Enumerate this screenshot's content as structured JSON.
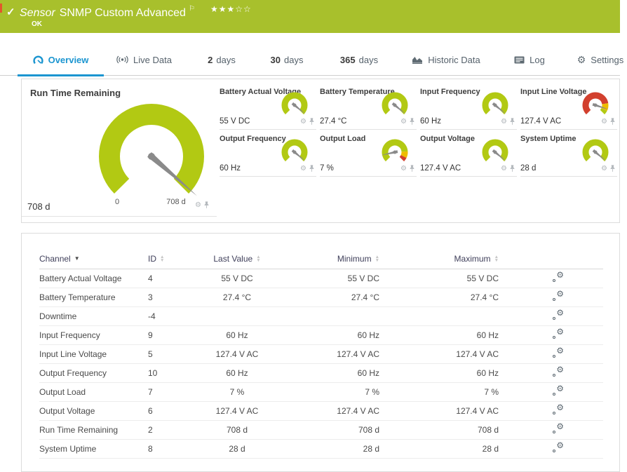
{
  "header": {
    "status_icon": "✓",
    "type_label": "Sensor",
    "title": "SNMP Custom Advanced",
    "flag_icon": "⚐",
    "stars_filled": "★★★",
    "stars_empty": "☆☆",
    "status": "OK"
  },
  "colors": {
    "header_green": "#a8c02c",
    "gauge_green": "#b2c913",
    "red": "#d2402e",
    "yellow": "#eebc00",
    "accent_blue": "#1b95d0"
  },
  "tabs": [
    {
      "name": "overview",
      "icon": "gauge-icon",
      "label": "Overview",
      "active": true
    },
    {
      "name": "live-data",
      "icon": "live-data-icon",
      "label": "Live Data"
    },
    {
      "name": "2-days",
      "label_strong": "2",
      "label": "days"
    },
    {
      "name": "30-days",
      "label_strong": "30",
      "label": "days"
    },
    {
      "name": "365-days",
      "label_strong": "365",
      "label": "days"
    },
    {
      "name": "historic-data",
      "icon": "historic-data-icon",
      "label": "Historic Data"
    },
    {
      "name": "log",
      "icon": "log-icon",
      "label": "Log"
    },
    {
      "name": "settings",
      "icon": "gear-icon",
      "label": "Settings"
    }
  ],
  "gauges": {
    "main": {
      "name": "Run Time Remaining",
      "value": "708 d",
      "min_label": "0",
      "max_label": "708 d",
      "needle_frac": 0.985,
      "zones": [
        {
          "from": 0,
          "to": 1,
          "color": "gauge_green"
        }
      ]
    },
    "small": [
      {
        "name": "Battery Actual Voltage",
        "value": "55 V DC",
        "needle_frac": 0.98,
        "zones": [
          {
            "from": 0,
            "to": 1,
            "color": "gauge_green"
          }
        ]
      },
      {
        "name": "Battery Temperature",
        "value": "27.4 °C",
        "needle_frac": 0.98,
        "zones": [
          {
            "from": 0,
            "to": 1,
            "color": "gauge_green"
          }
        ]
      },
      {
        "name": "Input Frequency",
        "value": "60 Hz",
        "needle_frac": 0.98,
        "zones": [
          {
            "from": 0,
            "to": 1,
            "color": "gauge_green"
          }
        ]
      },
      {
        "name": "Input Line Voltage",
        "value": "127.4 V AC",
        "needle_frac": 0.9,
        "zones": [
          {
            "from": 0,
            "to": 0.8,
            "color": "red"
          },
          {
            "from": 0.8,
            "to": 0.93,
            "color": "yellow"
          },
          {
            "from": 0.93,
            "to": 1,
            "color": "gauge_green"
          }
        ]
      },
      {
        "name": "Output Frequency",
        "value": "60 Hz",
        "needle_frac": 0.98,
        "zones": [
          {
            "from": 0,
            "to": 1,
            "color": "gauge_green"
          }
        ]
      },
      {
        "name": "Output Load",
        "value": "7 %",
        "needle_frac": 0.12,
        "zones": [
          {
            "from": 0,
            "to": 0.82,
            "color": "gauge_green"
          },
          {
            "from": 0.82,
            "to": 0.93,
            "color": "yellow"
          },
          {
            "from": 0.93,
            "to": 1,
            "color": "red"
          }
        ]
      },
      {
        "name": "Output Voltage",
        "value": "127.4 V AC",
        "needle_frac": 0.98,
        "zones": [
          {
            "from": 0,
            "to": 1,
            "color": "gauge_green"
          }
        ]
      },
      {
        "name": "System Uptime",
        "value": "28 d",
        "needle_frac": 0.98,
        "zones": [
          {
            "from": 0,
            "to": 1,
            "color": "gauge_green"
          }
        ]
      }
    ]
  },
  "table": {
    "columns": [
      {
        "label": "Channel",
        "sorted": true
      },
      {
        "label": "ID",
        "sorted": false
      },
      {
        "label": "Last Value",
        "sorted": false
      },
      {
        "label": "Minimum",
        "sorted": false
      },
      {
        "label": "Maximum",
        "sorted": false
      }
    ],
    "rows": [
      [
        "Battery Actual Voltage",
        "4",
        "55 V DC",
        "55 V DC",
        "55 V DC"
      ],
      [
        "Battery Temperature",
        "3",
        "27.4 °C",
        "27.4 °C",
        "27.4 °C"
      ],
      [
        "Downtime",
        "-4",
        "",
        "",
        ""
      ],
      [
        "Input Frequency",
        "9",
        "60 Hz",
        "60 Hz",
        "60 Hz"
      ],
      [
        "Input Line Voltage",
        "5",
        "127.4 V AC",
        "127.4 V AC",
        "127.4 V AC"
      ],
      [
        "Output Frequency",
        "10",
        "60 Hz",
        "60 Hz",
        "60 Hz"
      ],
      [
        "Output Load",
        "7",
        "7 %",
        "7 %",
        "7 %"
      ],
      [
        "Output Voltage",
        "6",
        "127.4 V AC",
        "127.4 V AC",
        "127.4 V AC"
      ],
      [
        "Run Time Remaining",
        "2",
        "708 d",
        "708 d",
        "708 d"
      ],
      [
        "System Uptime",
        "8",
        "28 d",
        "28 d",
        "28 d"
      ]
    ]
  }
}
